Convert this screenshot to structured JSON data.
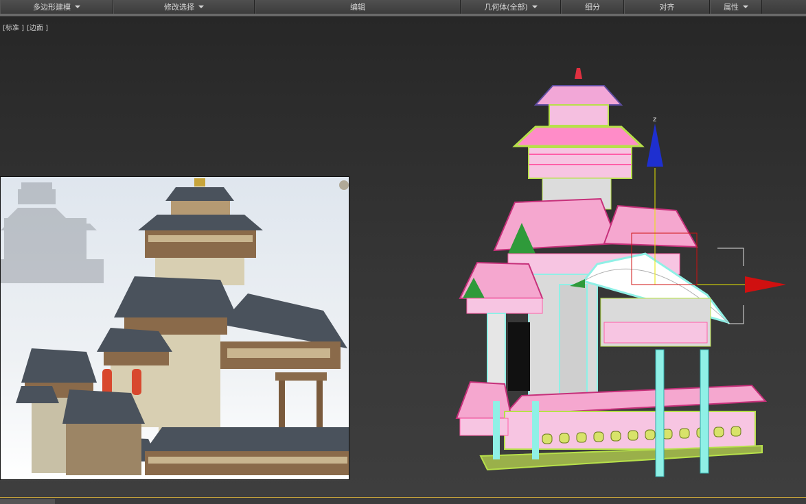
{
  "ribbon": {
    "tabs": [
      {
        "label": "多边形建模",
        "dropdown": true
      },
      {
        "label": "修改选择",
        "dropdown": true
      },
      {
        "label": "编辑",
        "dropdown": false
      },
      {
        "label": "几何体(全部)",
        "dropdown": true
      },
      {
        "label": "细分",
        "dropdown": false
      },
      {
        "label": "对齐",
        "dropdown": false
      },
      {
        "label": "属性",
        "dropdown": true
      }
    ]
  },
  "viewport": {
    "label_view": "[标准 ]",
    "label_shading": "[边面 ]",
    "gizmo": {
      "z_axis_label": "z",
      "z_color": "#1e2fd0",
      "x_color": "#d01010"
    }
  },
  "colors": {
    "wire_pink": "#ff5fa8",
    "wire_green": "#b7e04a",
    "wire_cyan": "#8ff0e6",
    "roof_dark": "#4a525c",
    "wood": "#8a6a4a",
    "status_accent": "#c2a03b"
  }
}
